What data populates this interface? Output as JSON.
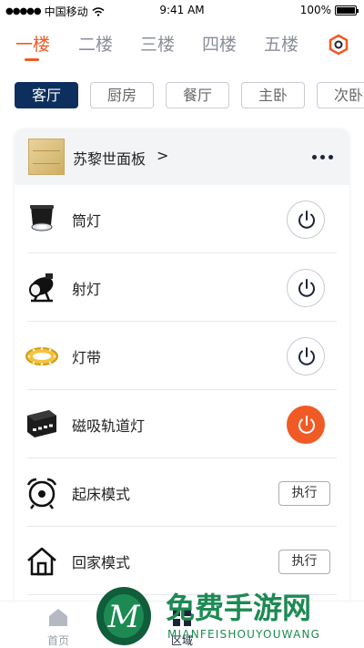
{
  "status_bar": {
    "carrier": "中国移动",
    "time": "9:41 AM",
    "battery": "100%"
  },
  "floors": [
    {
      "label": "一楼",
      "active": true
    },
    {
      "label": "二楼",
      "active": false
    },
    {
      "label": "三楼",
      "active": false
    },
    {
      "label": "四楼",
      "active": false
    },
    {
      "label": "五楼",
      "active": false
    }
  ],
  "rooms": [
    {
      "label": "客厅",
      "active": true
    },
    {
      "label": "厨房",
      "active": false
    },
    {
      "label": "餐厅",
      "active": false
    },
    {
      "label": "主卧",
      "active": false
    },
    {
      "label": "次卧",
      "active": false
    }
  ],
  "panel": {
    "title": "苏黎世面板",
    "chevron": ">"
  },
  "devices": [
    {
      "label": "筒灯",
      "icon": "downlight-icon",
      "state": "off"
    },
    {
      "label": "射灯",
      "icon": "spotlight-icon",
      "state": "off"
    },
    {
      "label": "灯带",
      "icon": "light-strip-icon",
      "state": "off"
    },
    {
      "label": "磁吸轨道灯",
      "icon": "track-light-icon",
      "state": "on"
    }
  ],
  "scenes": [
    {
      "label": "起床模式",
      "icon": "alarm-clock-icon",
      "action": "执行"
    },
    {
      "label": "回家模式",
      "icon": "home-icon",
      "action": "执行"
    }
  ],
  "bottom_nav": [
    {
      "label": "首页",
      "icon": "home-nav-icon",
      "active": false
    },
    {
      "label": "区域",
      "icon": "area-nav-icon",
      "active": true
    }
  ],
  "watermark": {
    "title": "免费手游网",
    "subtitle": "MIANFEISHOUYOUWANG"
  },
  "colors": {
    "accent": "#f05a24",
    "active_room_bg": "#0d2f5e",
    "inactive_text": "#8a8f99"
  }
}
